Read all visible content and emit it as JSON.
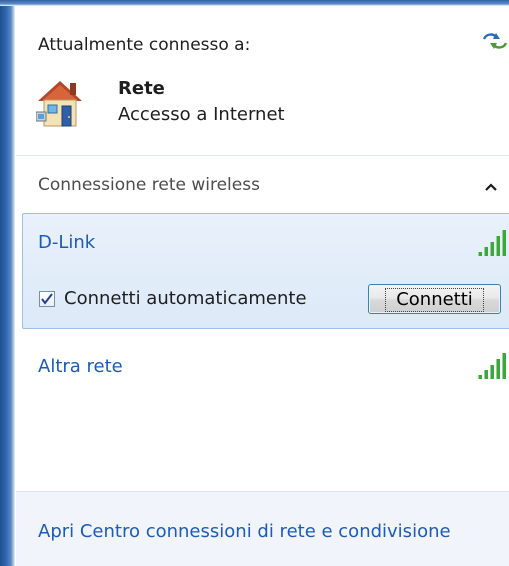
{
  "header": {
    "title": "Attualmente connesso a:",
    "refresh_icon": "refresh-icon"
  },
  "current_network": {
    "icon": "house-network-icon",
    "name": "Rete",
    "access": "Accesso a Internet"
  },
  "section": {
    "title": "Connessione rete wireless",
    "toggle_icon": "chevron-up-icon"
  },
  "networks": [
    {
      "name": "D-Link",
      "signal_icon": "signal-strength-icon",
      "selected": true,
      "auto_connect_label": "Connetti automaticamente",
      "auto_connect_checked": true,
      "connect_label": "Connetti"
    },
    {
      "name": "Altra rete",
      "signal_icon": "signal-strength-icon",
      "selected": false
    }
  ],
  "footer": {
    "link": "Apri Centro connessioni di rete e condivisione"
  },
  "colors": {
    "link": "#1c5bb8",
    "selection_bg": "#dce9f8",
    "selection_border": "#9fbee5",
    "signal": "#3fa63f",
    "frame": "#2f67ad"
  }
}
